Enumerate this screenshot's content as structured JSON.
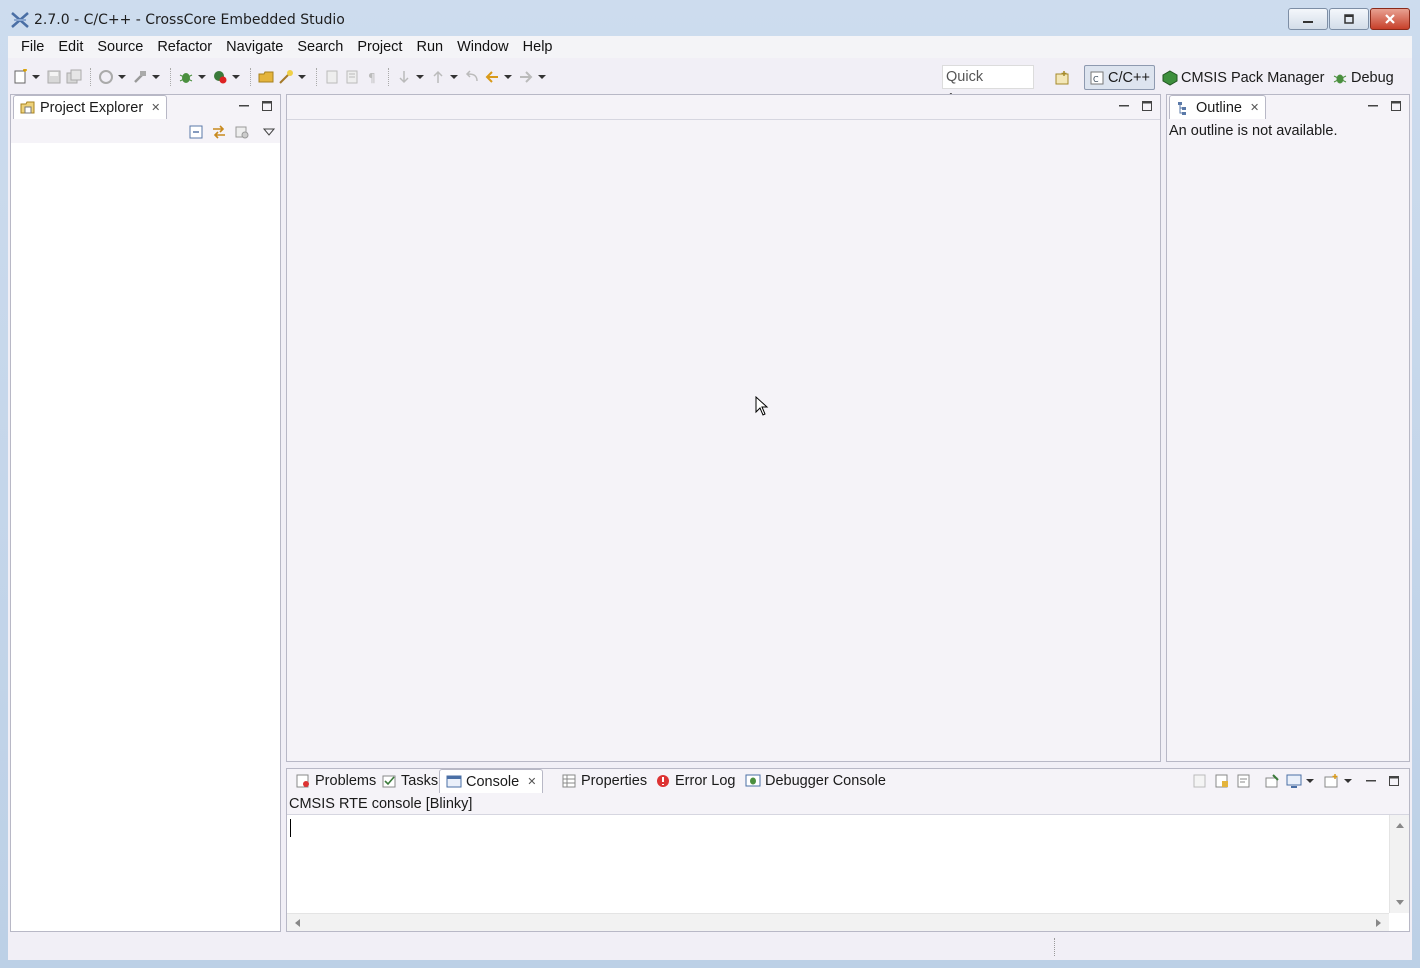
{
  "window": {
    "title": "2.7.0 - C/C++ - CrossCore Embedded Studio",
    "minimize_icon": "minimize-icon",
    "restore_icon": "restore-icon",
    "close_icon": "close-icon"
  },
  "menu": [
    "File",
    "Edit",
    "Source",
    "Refactor",
    "Navigate",
    "Search",
    "Project",
    "Run",
    "Window",
    "Help"
  ],
  "toolbar": {
    "quick_access_placeholder": "Quick Access"
  },
  "perspectives": {
    "cpp": "C/C++",
    "cmsis": "CMSIS Pack Manager",
    "debug": "Debug"
  },
  "project_explorer": {
    "tab": "Project Explorer"
  },
  "outline": {
    "tab": "Outline",
    "message": "An outline is not available."
  },
  "bottom_panel": {
    "tabs": [
      "Problems",
      "Tasks",
      "Console",
      "Properties",
      "Error Log",
      "Debugger Console"
    ],
    "active_tab": "Console",
    "console_title": "CMSIS RTE console [Blinky]"
  },
  "colors": {
    "accent": "#4a6fa5",
    "window_frame": "#c9d9ec",
    "close_button": "#c7402a"
  }
}
